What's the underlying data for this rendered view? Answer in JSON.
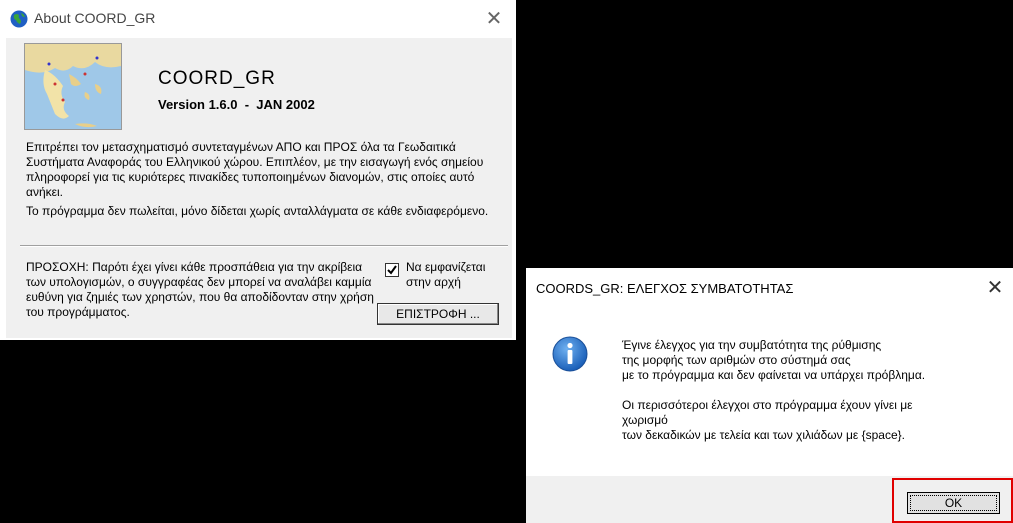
{
  "about": {
    "title": "About COORD_GR",
    "close_symbol": "✕",
    "app_name": "COORD_GR",
    "version": "Version 1.6.0  -  JAN 2002",
    "description_1": "Επιτρέπει τον μετασχηματισμό συντεταγμένων ΑΠΟ και ΠΡΟΣ όλα τα Γεωδαιτικά Συστήματα Αναφοράς του Ελληνικού χώρου. Επιπλέον, με την εισαγωγή ενός σημείου πληροφορεί για τις κυριότερες πινακίδες τυποποιημένων διανομών, στις οποίες αυτό ανήκει.",
    "description_2": "Το πρόγραμμα δεν πωλείται, μόνο δίδεται χωρίς ανταλλάγματα σε κάθε ενδιαφερόμενο.",
    "warning": "ΠΡΟΣΟΧΗ: Παρότι έχει γίνει κάθε προσπάθεια για την ακρίβεια των υπολογισμών, ο συγγραφέας δεν μπορεί να αναλάβει καμμία ευθύνη για ζημιές των χρηστών, που θα αποδίδονταν στην χρήση του προγράμματος.",
    "show_at_start_label": "Να εμφανίζεται στην αρχή",
    "show_at_start_checked": true,
    "back_button": "ΕΠΙΣΤΡΟΦΗ ..."
  },
  "compat": {
    "title": "COORDS_GR: ΕΛΕΓΧΟΣ ΣΥΜΒΑΤΟΤΗΤΑΣ",
    "close_symbol": "✕",
    "message_lines_1": [
      "Έγινε έλεγχος για την συμβατότητα της ρύθμισης",
      "της μορφής των αριθμών στο σύστημά σας",
      "με το πρόγραμμα και δεν φαίνεται να υπάρχει πρόβλημα."
    ],
    "message_lines_2": [
      "Οι περισσότεροι έλεγχοι στο πρόγραμμα έχουν γίνει με",
      "χωρισμό",
      "των δεκαδικών με τελεία και των χιλιάδων με {space}."
    ],
    "ok_button": "OK",
    "highlight_color": "#e00000"
  }
}
